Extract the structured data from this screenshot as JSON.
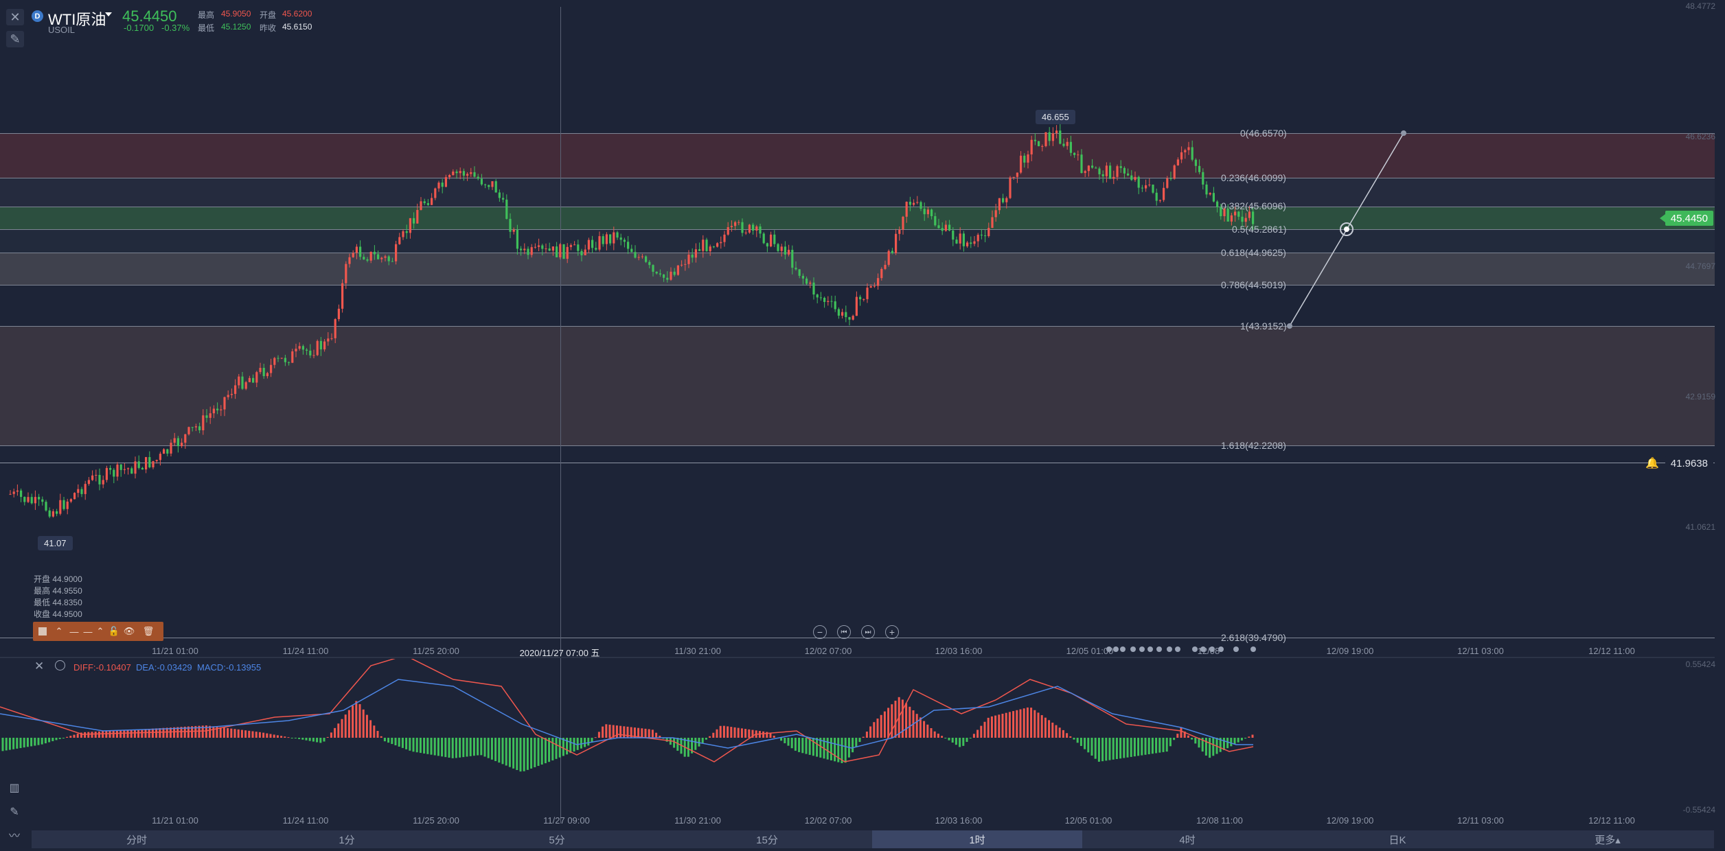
{
  "header": {
    "symbol_name": "WTI原油",
    "symbol_code": "USOIL",
    "logo_letter": "D",
    "last_price": "45.4450",
    "change": "-0.1700",
    "change_pct": "-0.37%",
    "high_label": "最高",
    "high_value": "45.9050",
    "open_label": "开盘",
    "open_value": "45.6200",
    "low_label": "最低",
    "low_value": "45.1250",
    "prev_close_label": "昨收",
    "prev_close_value": "45.6150"
  },
  "fib_levels": [
    {
      "label": "0(46.6570)",
      "value": 46.657
    },
    {
      "label": "0.236(46.0099)",
      "value": 46.0099
    },
    {
      "label": "0.382(45.6096)",
      "value": 45.6096
    },
    {
      "label": "0.5(45.2861)",
      "value": 45.2861
    },
    {
      "label": "0.618(44.9625)",
      "value": 44.9625
    },
    {
      "label": "0.786(44.5019)",
      "value": 44.5019
    },
    {
      "label": "1(43.9152)",
      "value": 43.9152
    },
    {
      "label": "1.618(42.2208)",
      "value": 42.2208
    },
    {
      "label": "2.618(39.4790)",
      "value": 39.479
    }
  ],
  "price_axis": [
    "48.4772",
    "46.6236",
    "44.7697",
    "42.9159",
    "41.0621"
  ],
  "current_price_tag": "45.4450",
  "alert_price_tag": "41.9638",
  "max_marker": "46.655",
  "min_marker": "41.07",
  "crosshair_time": "2020/11/27 07:00 五",
  "main_time_axis": [
    "11/21 01:00",
    "11/24 11:00",
    "11/25 20:00",
    "11/30 21:00",
    "12/02 07:00",
    "12/03 16:00",
    "12/05 01:00",
    "12/08",
    "12/09 19:00",
    "12/11 03:00",
    "12/12 11:00"
  ],
  "macd_time_axis": [
    "11/21 01:00",
    "11/24 11:00",
    "11/25 20:00",
    "11/27 09:00",
    "11/30 21:00",
    "12/02 07:00",
    "12/03 16:00",
    "12/05 01:00",
    "12/08 11:00",
    "12/09 19:00",
    "12/11 03:00",
    "12/12 11:00"
  ],
  "ohlc_info": [
    {
      "label": "开盘",
      "value": "44.9000"
    },
    {
      "label": "最高",
      "value": "44.9550"
    },
    {
      "label": "最低",
      "value": "44.8350"
    },
    {
      "label": "收盘",
      "value": "44.9500"
    }
  ],
  "macd": {
    "diff_label": "DIFF:-0.10407",
    "dea_label": "DEA:-0.03429",
    "macd_label": "MACD:-0.13955",
    "axis_top": "0.55424",
    "axis_bottom": "-0.55424"
  },
  "timeframes": [
    {
      "label": "分时",
      "active": false
    },
    {
      "label": "1分",
      "active": false
    },
    {
      "label": "5分",
      "active": false
    },
    {
      "label": "15分",
      "active": false
    },
    {
      "label": "1时",
      "active": true
    },
    {
      "label": "4时",
      "active": false
    },
    {
      "label": "日K",
      "active": false
    },
    {
      "label": "更多▴",
      "active": false
    }
  ],
  "colors": {
    "background": "#1d2437",
    "up": "#f0574e",
    "down": "#3fc05a",
    "diff_line": "#f0574e",
    "dea_line": "#4d86e6",
    "band_red": "#6e3d4b",
    "band_green": "#3a6a4a",
    "band_gray": "#4c4d57"
  },
  "icons": {
    "close": "close-icon",
    "draw": "pencil-icon",
    "indicator": "chart-indicator-icon"
  }
}
